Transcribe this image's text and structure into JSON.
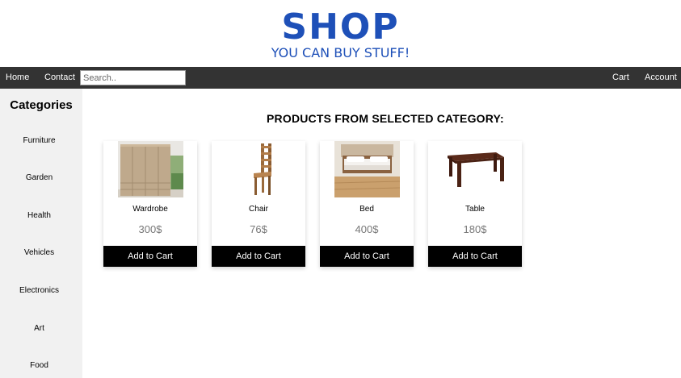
{
  "header": {
    "title": "SHOP",
    "subtitle": "YOU CAN BUY STUFF!"
  },
  "nav": {
    "home": "Home",
    "contact": "Contact",
    "search_placeholder": "Search..",
    "cart": "Cart",
    "account": "Account"
  },
  "sidebar": {
    "title": "Categories",
    "items": [
      {
        "label": "Furniture"
      },
      {
        "label": "Garden"
      },
      {
        "label": "Health"
      },
      {
        "label": "Vehicles"
      },
      {
        "label": "Electronics"
      },
      {
        "label": "Art"
      },
      {
        "label": "Food"
      }
    ]
  },
  "main": {
    "heading": "PRODUCTS FROM SELECTED CATEGORY:",
    "products": [
      {
        "name": "Wardrobe",
        "price": "300$",
        "button": "Add to Cart",
        "icon": "wardrobe-image"
      },
      {
        "name": "Chair",
        "price": "76$",
        "button": "Add to Cart",
        "icon": "chair-image"
      },
      {
        "name": "Bed",
        "price": "400$",
        "button": "Add to Cart",
        "icon": "bed-image"
      },
      {
        "name": "Table",
        "price": "180$",
        "button": "Add to Cart",
        "icon": "table-image"
      }
    ]
  },
  "colors": {
    "brand": "#1e50b8",
    "navbar": "#333333",
    "sidebar": "#f1f1f1",
    "button": "#000000",
    "price": "#777777"
  }
}
